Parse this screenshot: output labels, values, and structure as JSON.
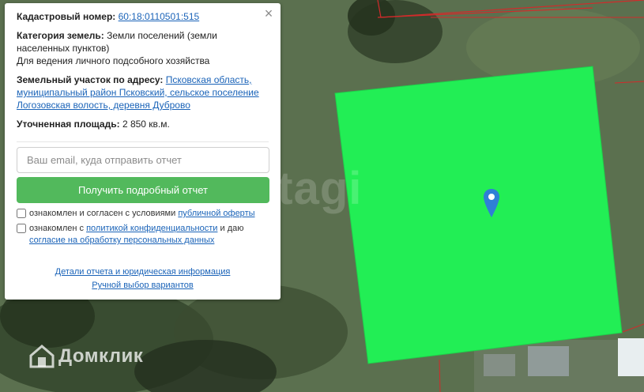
{
  "popup": {
    "cadastral_label": "Кадастровый номер:",
    "cadastral_number": "60:18:0110501:515",
    "category_label": "Категория земель:",
    "category_value": "Земли поселений (земли населенных пунктов)",
    "purpose": "Для ведения личного подсобного хозяйства",
    "address_label": "Земельный участок по адресу:",
    "address_value": "Псковская область, муниципальный район Псковский, сельское поселение Логозовская волость, деревня Дуброво",
    "area_label": "Уточненная площадь:",
    "area_value": "2 850 кв.м.",
    "email_placeholder": "Ваш email, куда отправить отчет",
    "submit_button": "Получить подробный отчет",
    "consent1_text": "ознакомлен и согласен с условиями",
    "consent1_link": "публичной оферты",
    "consent2_text": "ознакомлен с",
    "consent2_link": "политикой конфиденциальности",
    "consent2_and": "и даю",
    "consent2_link2": "согласие на обработку персональных данных",
    "details_link": "Детали отчета и юридическая информация",
    "manual_link": "Ручной выбор вариантов",
    "close_icon": "close-icon"
  },
  "map": {
    "parcel_color": "#22ee55",
    "pin_color": "#2f7fd6",
    "pin_icon": "map-pin-icon",
    "logo_text": "Домклик",
    "logo_icon": "house-icon",
    "watermark_text": "etagi"
  }
}
